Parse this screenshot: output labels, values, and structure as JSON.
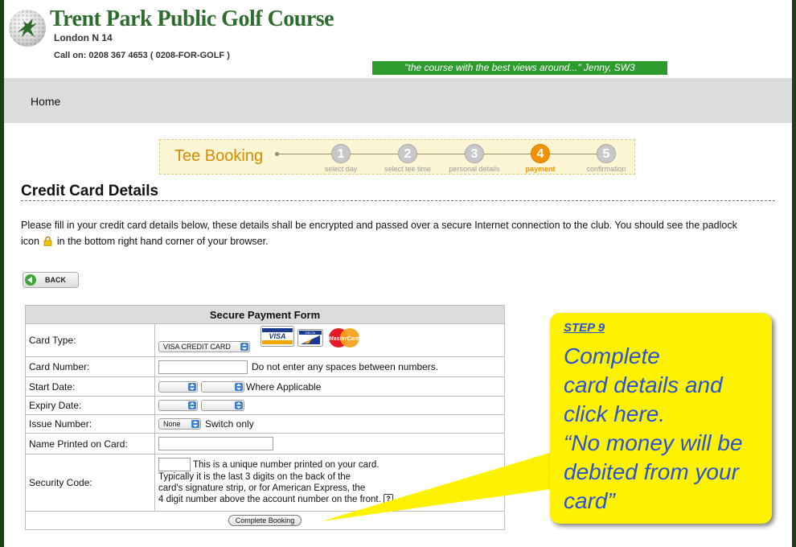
{
  "header": {
    "title": "Trent Park Public Golf Course",
    "location": "London N 14",
    "phone": "Call on: 0208 367 4653 ( 0208-FOR-GOLF )",
    "quote": "\"the course with the best views around...\" Jenny, SW3"
  },
  "nav": {
    "home": "Home"
  },
  "steps": {
    "title": "Tee Booking",
    "items": [
      {
        "num": "1",
        "label": "select day",
        "active": false
      },
      {
        "num": "2",
        "label": "select tee time",
        "active": false
      },
      {
        "num": "3",
        "label": "personal details",
        "active": false
      },
      {
        "num": "4",
        "label": "payment",
        "active": true
      },
      {
        "num": "5",
        "label": "confirmation",
        "active": false
      }
    ]
  },
  "page": {
    "title": "Credit Card Details",
    "intro_1": "Please fill in your credit card details below, these details shall be encrypted and passed over a secure Internet connection to the club. You should see the padlock",
    "intro_2a": "icon",
    "intro_2b": "in the bottom right hand corner of your browser.",
    "back": "BACK"
  },
  "form": {
    "heading": "Secure Payment Form",
    "card_type": {
      "label": "Card Type:",
      "value": "VISA CREDIT CARD",
      "logos": [
        "VISA",
        "DELTA",
        "MasterCard"
      ]
    },
    "card_number": {
      "label": "Card Number:",
      "note": "Do not enter any spaces between numbers."
    },
    "start_date": {
      "label": "Start Date:",
      "note": "Where Applicable"
    },
    "expiry_date": {
      "label": "Expiry Date:"
    },
    "issue_number": {
      "label": "Issue Number:",
      "value": "None",
      "note": "Switch only"
    },
    "name_on_card": {
      "label": "Name Printed on Card:"
    },
    "security_code": {
      "label": "Security Code:",
      "line1": "This is a unique number printed on your card.",
      "line2": "Typically it is the last 3 digits on the back of the",
      "line3": "card's signature strip, or for American Express, the",
      "line4": "4 digit number above the account number on the front.",
      "help": "?"
    },
    "submit": "Complete Booking"
  },
  "callout": {
    "step": "STEP 9",
    "lines": [
      "Complete",
      "card details and",
      "click here.",
      "“No money will be",
      "debited from your",
      "card”"
    ]
  },
  "colors": {
    "brand_green": "#2e6b2e",
    "accent_orange": "#f39200",
    "callout_yellow": "#fff200",
    "callout_text": "#2a52d6"
  }
}
